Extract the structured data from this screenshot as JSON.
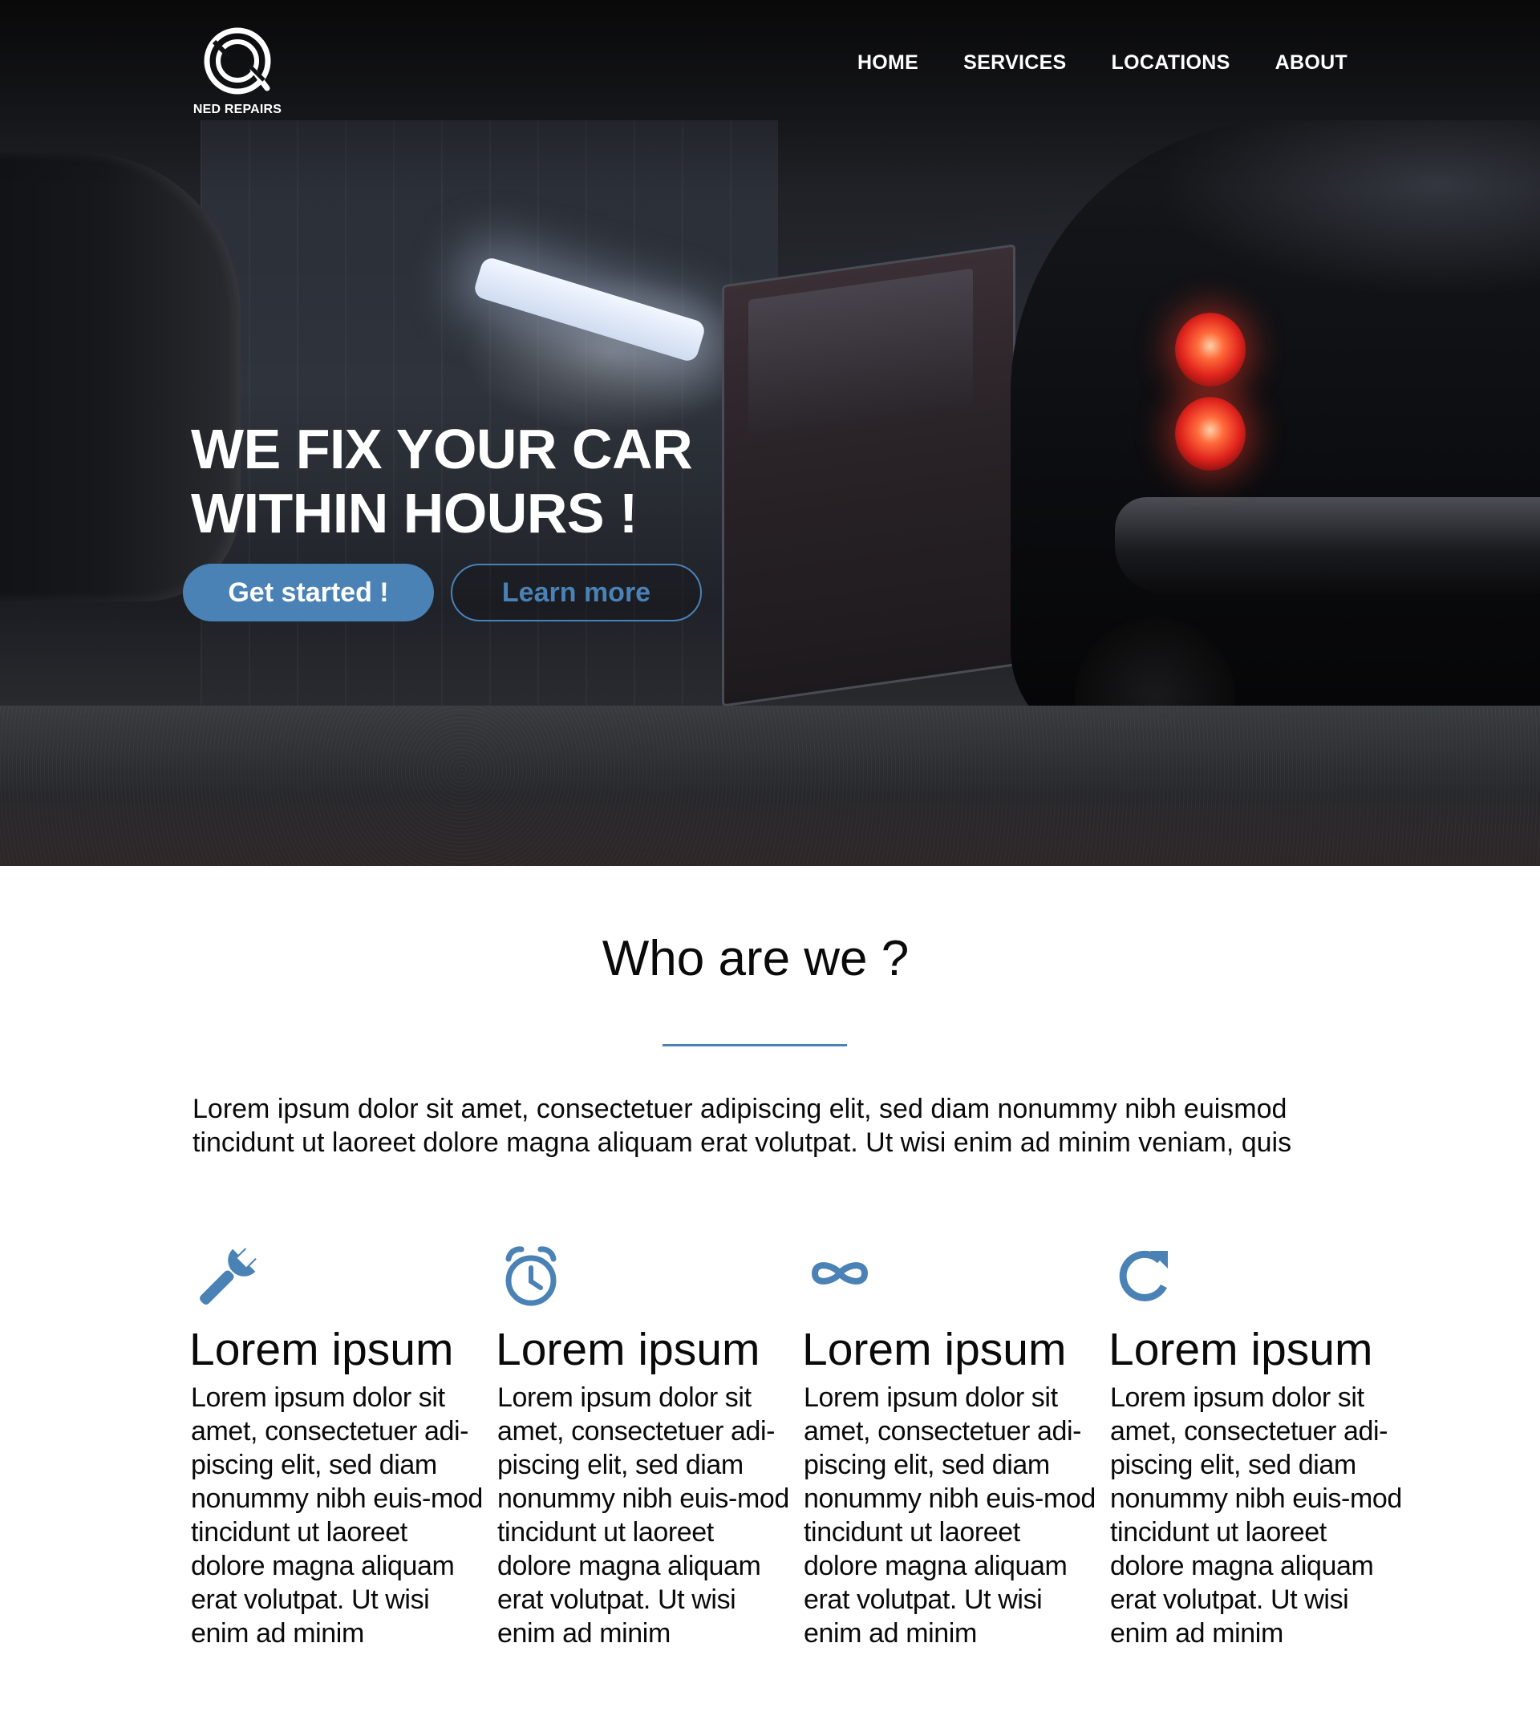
{
  "brand": {
    "name": "NED REPAIRS"
  },
  "nav": {
    "items": [
      {
        "label": "HOME"
      },
      {
        "label": "SERVICES"
      },
      {
        "label": "LOCATIONS"
      },
      {
        "label": "ABOUT"
      }
    ]
  },
  "hero": {
    "title_line1": "WE FIX YOUR CAR",
    "title_line2": "WITHIN HOURS !",
    "primary_button": "Get started !",
    "secondary_button": "Learn more"
  },
  "who": {
    "title": "Who are we ?",
    "text": "Lorem ipsum dolor sit amet, consectetuer adipiscing elit, sed diam nonummy nibh euismod tincidunt ut laoreet dolore magna aliquam erat volutpat. Ut wisi enim ad minim veniam, quis"
  },
  "features": [
    {
      "icon": "wrench-icon",
      "title": "Lorem ipsum",
      "text": "Lorem ipsum dolor sit amet, consectetuer adi-piscing elit, sed diam nonummy nibh euis-mod tincidunt ut laoreet dolore magna aliquam erat volutpat. Ut wisi enim ad minim"
    },
    {
      "icon": "alarm-clock-icon",
      "title": "Lorem ipsum",
      "text": "Lorem ipsum dolor sit amet, consectetuer adi-piscing elit, sed diam nonummy nibh euis-mod tincidunt ut laoreet dolore magna aliquam erat volutpat. Ut wisi enim ad minim"
    },
    {
      "icon": "infinity-icon",
      "title": "Lorem ipsum",
      "text": "Lorem ipsum dolor sit amet, consectetuer adi-piscing elit, sed diam nonummy nibh euis-mod tincidunt ut laoreet dolore magna aliquam erat volutpat. Ut wisi enim ad minim"
    },
    {
      "icon": "refresh-icon",
      "title": "Lorem ipsum",
      "text": "Lorem ipsum dolor sit amet, consectetuer adi-piscing elit, sed diam nonummy nibh euis-mod tincidunt ut laoreet dolore magna aliquam erat volutpat. Ut wisi enim ad minim"
    }
  ],
  "colors": {
    "accent": "#4a82b6",
    "text": "#0a0a0a",
    "hero_text": "#ffffff"
  }
}
